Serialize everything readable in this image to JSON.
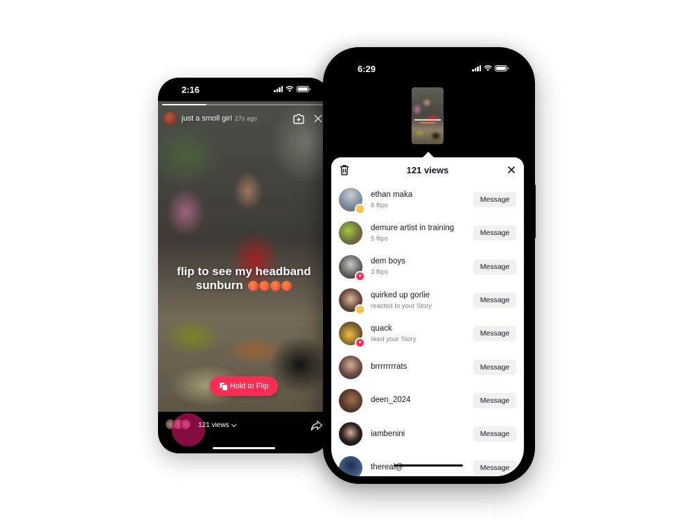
{
  "story_phone": {
    "status": {
      "time": "2:16"
    },
    "progress": 0.27,
    "header": {
      "username": "just a smoll girl",
      "timestamp": "27s ago"
    },
    "caption": {
      "line1": "flip to see my headband",
      "line2": "sunburn",
      "emoji": [
        "hot-face",
        "hot-face",
        "hot-face",
        "hot-face"
      ]
    },
    "hold_button": {
      "label": "Hold to Flip",
      "icon": "flip-icon"
    },
    "footer": {
      "views_label": "121 views"
    },
    "accent_color": "#fe2c55"
  },
  "viewers_phone": {
    "status": {
      "time": "6:29"
    },
    "sheet": {
      "title": "121 views",
      "message_label": "Message",
      "viewers": [
        {
          "name": "ethan maka",
          "sub": "8 flips",
          "badge": "laugh"
        },
        {
          "name": "demure artist in training",
          "sub": "5 flips",
          "badge": ""
        },
        {
          "name": "dem boys",
          "sub": "3 flips",
          "badge": "heart"
        },
        {
          "name": "quirked up gorlie",
          "sub": "reacted to your Story",
          "badge": "laugh"
        },
        {
          "name": "quack",
          "sub": "liked your Story",
          "badge": "heart"
        },
        {
          "name": "brrrrrrrrats",
          "sub": "",
          "badge": ""
        },
        {
          "name": "deen_2024",
          "sub": "",
          "badge": ""
        },
        {
          "name": "iambenini",
          "sub": "",
          "badge": ""
        },
        {
          "name": "thereal@",
          "sub": "",
          "badge": ""
        }
      ]
    }
  }
}
